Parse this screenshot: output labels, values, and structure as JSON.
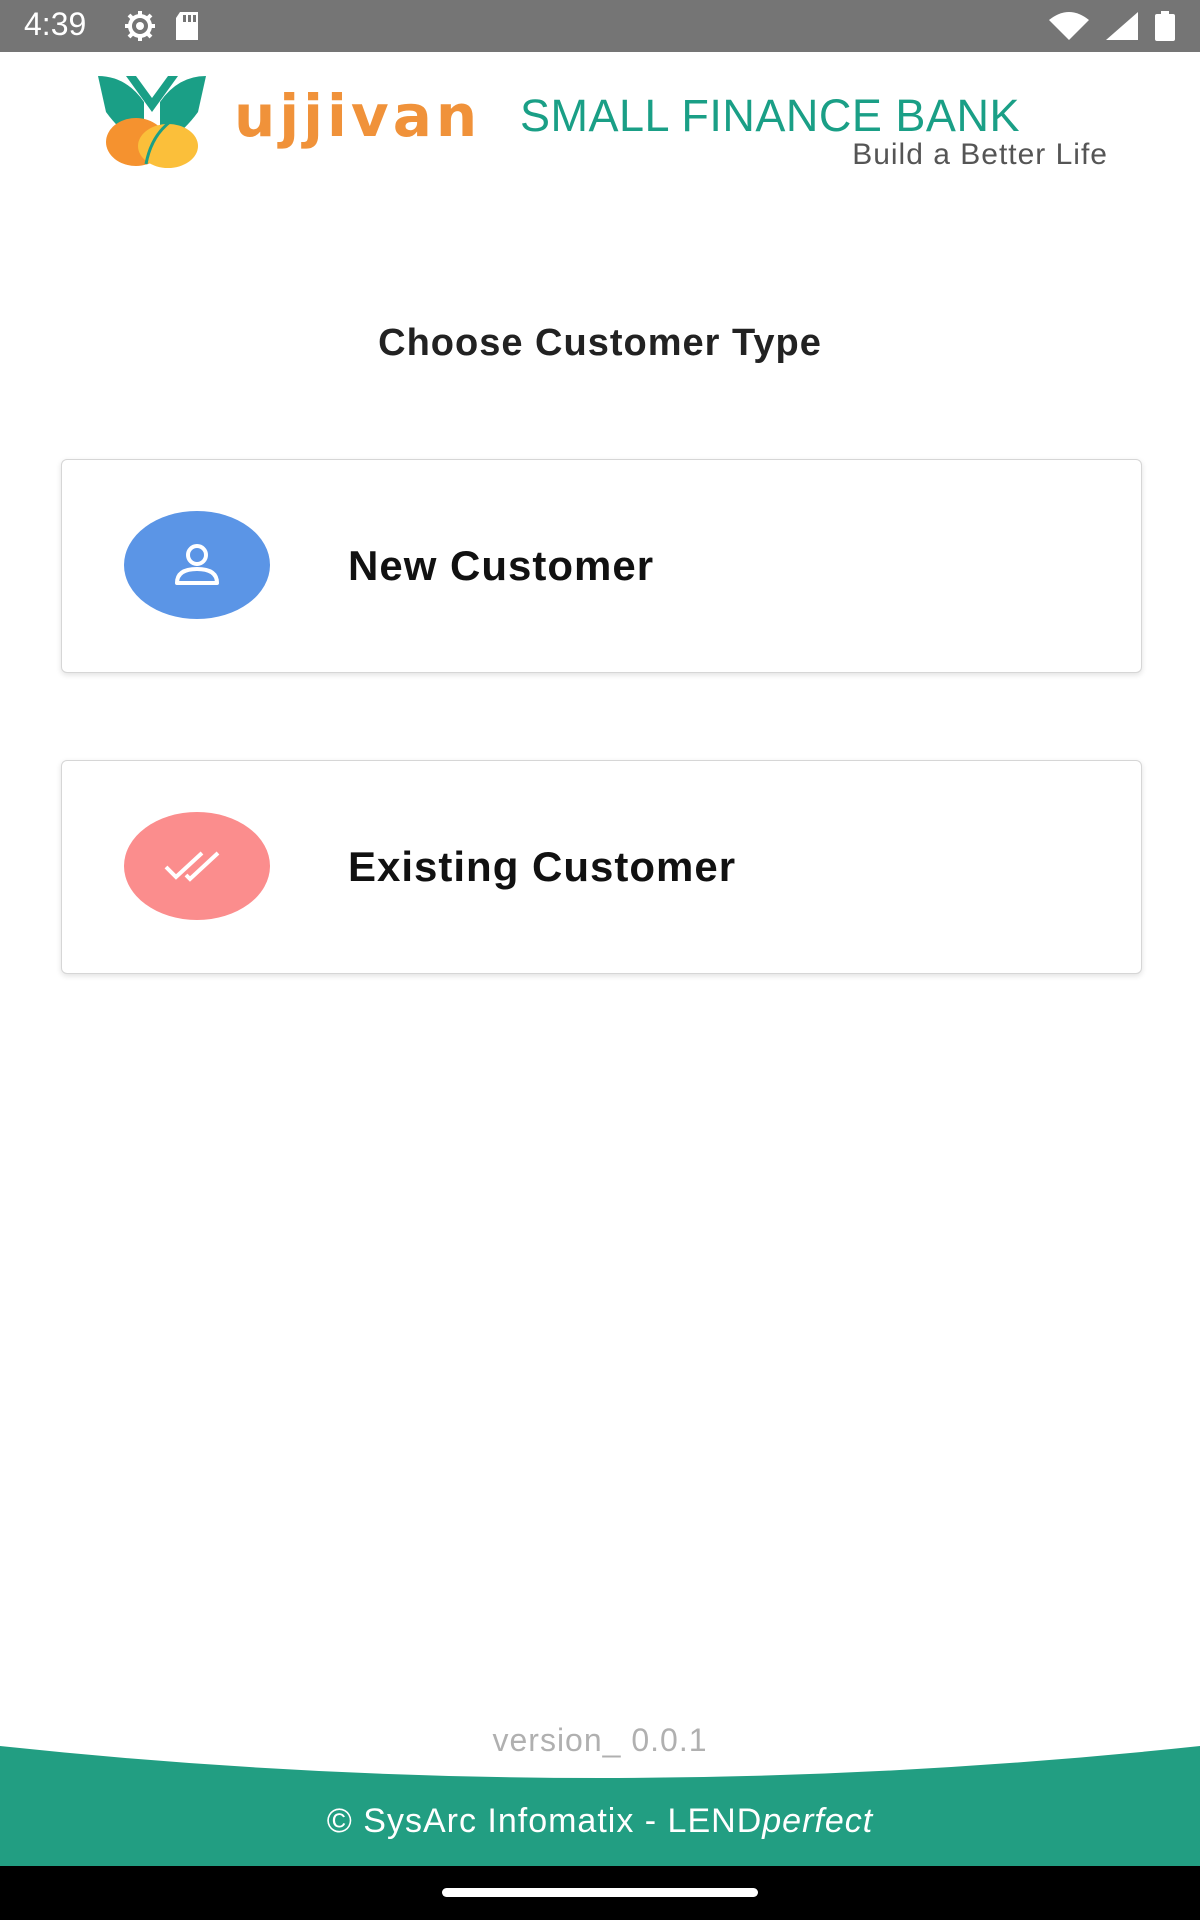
{
  "status_bar": {
    "time": "4:39",
    "icons": [
      "settings-icon",
      "sd-card-icon",
      "wifi-icon",
      "signal-icon",
      "battery-icon"
    ]
  },
  "header": {
    "logo_word": "ujjivan",
    "logo_bank": "SMALL FINANCE BANK",
    "logo_tagline": "Build a Better Life"
  },
  "main": {
    "title": "Choose Customer Type",
    "options": [
      {
        "label": "New Customer",
        "icon": "person-icon",
        "color": "#5b95e6"
      },
      {
        "label": "Existing Customer",
        "icon": "double-check-icon",
        "color": "#fb8d8d"
      }
    ]
  },
  "footer": {
    "version": "version_ 0.0.1",
    "copyright_prefix": "© SysArc Infomatix - LEND",
    "copyright_italic": "perfect"
  },
  "colors": {
    "accent_green": "#1a9f86",
    "brand_orange": "#f0923a",
    "status_bar": "#757575"
  }
}
